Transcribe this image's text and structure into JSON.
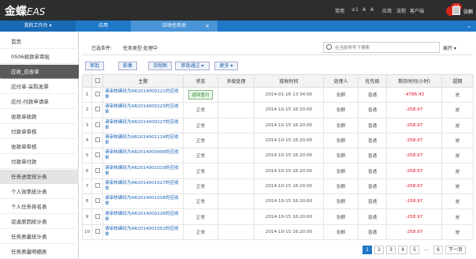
{
  "top": {
    "brand": "金蝶",
    "brand_suffix": "EAS",
    "nav": [
      "常用",
      "A",
      "A",
      "应用",
      "流程",
      "客户端"
    ],
    "nav_small": "±1",
    "badge": "18",
    "user": "张麒"
  },
  "tabs": {
    "work": "我的工作台",
    "app": "应用",
    "receivable": "应收任务池",
    "close": "×"
  },
  "sidebar": {
    "items": [
      {
        "label": "首页"
      },
      {
        "label": "0506收款单审批"
      },
      {
        "label": "应收_应收单"
      },
      {
        "label": "应付单-采购发票"
      },
      {
        "label": "应付-付款申请单"
      },
      {
        "label": "收款单收款"
      },
      {
        "label": "付款单审核"
      },
      {
        "label": "收款单审核"
      },
      {
        "label": "付款单付款"
      },
      {
        "label": "任务进度统计表"
      },
      {
        "label": "个人效率统计表"
      },
      {
        "label": "个人任务排名表"
      },
      {
        "label": "驳退原因统计表"
      },
      {
        "label": "任务质量统计表"
      },
      {
        "label": "任务质量明细表"
      }
    ]
  },
  "filter": {
    "label": "已选条件:",
    "value": "任务类型:处理中",
    "search_placeholder": "在当前条件下搜索",
    "more": "展开"
  },
  "toolbar": [
    "审批",
    "影像",
    "流程图",
    "审批通过",
    "更多"
  ],
  "table": {
    "headers": [
      "",
      "",
      "主题",
      "状态",
      "多级处理",
      "接收时间",
      "处理人",
      "优先级",
      "剩余时间(小时)",
      "超期"
    ],
    "rows": [
      {
        "n": "1",
        "subject": "请审核编码为AR2014000221的应收单",
        "status": "退回重扫",
        "time": "2014-01-16 13:34:00",
        "handler": "张麒",
        "priority": "普通",
        "remain": "-4786.43",
        "over": "是"
      },
      {
        "n": "2",
        "subject": "请审核编码为AR2014000223的应收单",
        "status": "正常",
        "time": "2014-10-15 16:20:00",
        "handler": "张麒",
        "priority": "普通",
        "remain": "-258.97",
        "over": "是"
      },
      {
        "n": "3",
        "subject": "请审核编码为AR2014000227的应收单",
        "status": "正常",
        "time": "2014-10-15 16:20:00",
        "handler": "张麒",
        "priority": "普通",
        "remain": "-258.97",
        "over": "是"
      },
      {
        "n": "4",
        "subject": "请审核编码为AR2014001114的应收单",
        "status": "正常",
        "time": "2014-10-15 16:20:00",
        "handler": "张麒",
        "priority": "普通",
        "remain": "-258.97",
        "over": "是"
      },
      {
        "n": "5",
        "subject": "请审核编码为AR2014000998的应收单",
        "status": "正常",
        "time": "2014-10-15 16:20:00",
        "handler": "张麒",
        "priority": "普通",
        "remain": "-258.97",
        "over": "是"
      },
      {
        "n": "6",
        "subject": "请审核编码为AR2014001019的应收单",
        "status": "正常",
        "time": "2014-10-15 16:20:00",
        "handler": "张麒",
        "priority": "普通",
        "remain": "-258.97",
        "over": "是"
      },
      {
        "n": "7",
        "subject": "请审核编码为AR2014001027的应收单",
        "status": "正常",
        "time": "2014-10-15 16:20:00",
        "handler": "张麒",
        "priority": "普通",
        "remain": "-258.97",
        "over": "是"
      },
      {
        "n": "8",
        "subject": "请审核编码为AR2014001018的应收单",
        "status": "正常",
        "time": "2014-10-15 16:20:00",
        "handler": "张麒",
        "priority": "普通",
        "remain": "-258.97",
        "over": "是"
      },
      {
        "n": "9",
        "subject": "请审核编码为AR2014000226的应收单",
        "status": "正常",
        "time": "2014-10-15 16:20:00",
        "handler": "张麒",
        "priority": "普通",
        "remain": "-258.97",
        "over": "是"
      },
      {
        "n": "10",
        "subject": "请审核编码为AR2014001052的应收单",
        "status": "正常",
        "time": "2014-10-15 16:20:00",
        "handler": "张麒",
        "priority": "普通",
        "remain": "-258.97",
        "over": "是"
      }
    ]
  },
  "pager": [
    "1",
    "2",
    "3",
    "4",
    "5",
    "6",
    "下一页"
  ],
  "colors": {
    "topbar": "#2d2d2d",
    "tabbar": "#1f78c8",
    "active_side": "#5a5a5a",
    "link": "#1a63b8",
    "negative": "#d12"
  }
}
